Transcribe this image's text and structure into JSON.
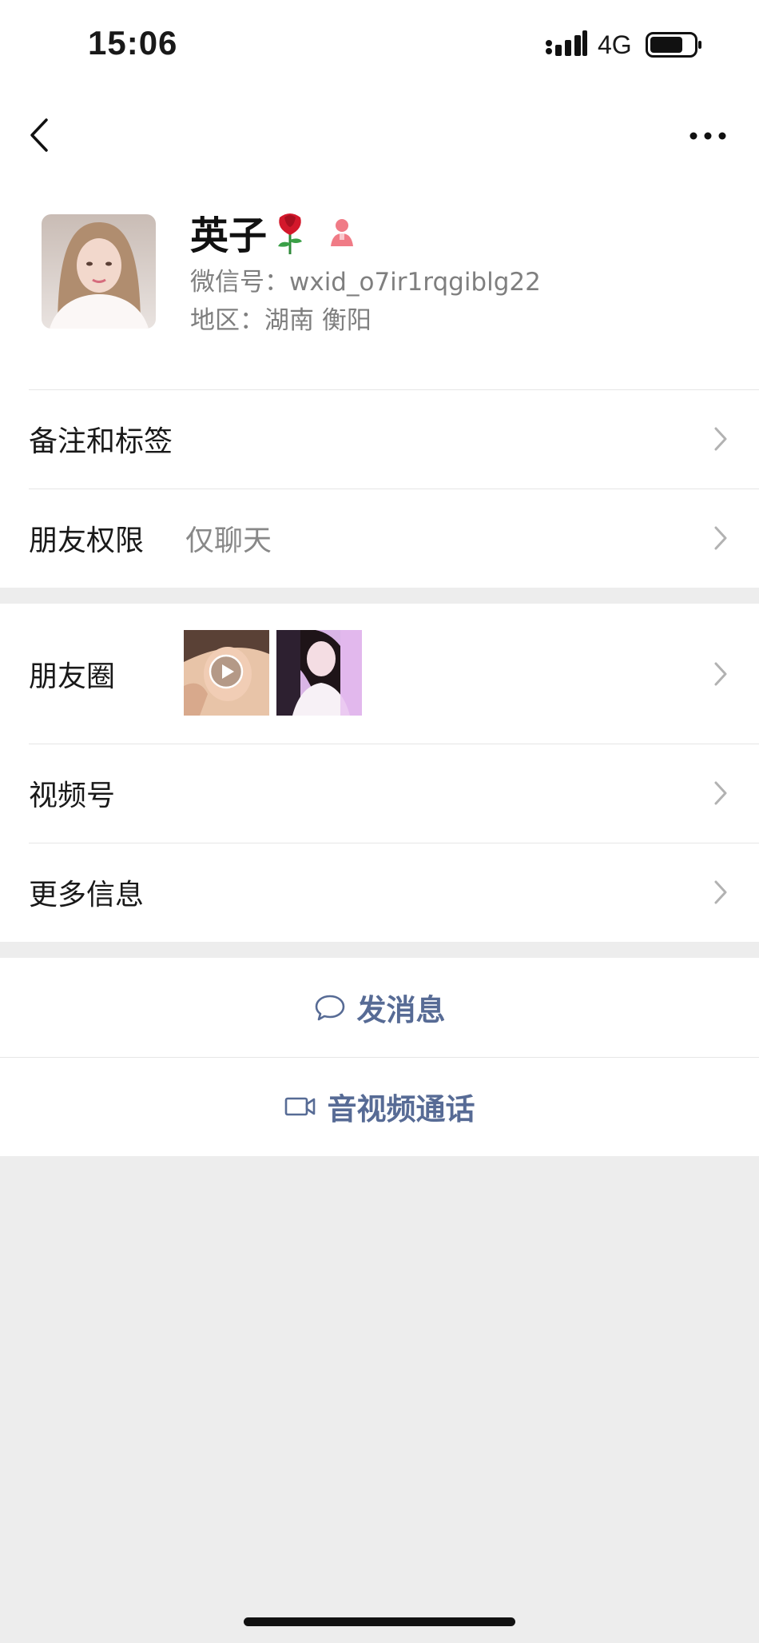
{
  "status_bar": {
    "time": "15:06",
    "network": "4G"
  },
  "nav": {
    "back_icon": "back-chevron-icon",
    "more_icon": "more-dots-icon"
  },
  "profile": {
    "name": "英子",
    "wechat_id": "微信号：wxid_o7ir1rqgiblg22",
    "region": "地区：湖南 衡阳",
    "badge_icons": [
      "rose-icon",
      "female-gender-icon"
    ]
  },
  "rows": {
    "remarks": {
      "label": "备注和标签"
    },
    "permissions": {
      "label": "朋友权限",
      "value": "仅聊天"
    },
    "moments": {
      "label": "朋友圈"
    },
    "channels": {
      "label": "视频号"
    },
    "more_info": {
      "label": "更多信息"
    }
  },
  "actions": {
    "message": {
      "label": "发消息",
      "icon": "chat-bubble-icon"
    },
    "call": {
      "label": "音视频通话",
      "icon": "video-camera-icon"
    }
  },
  "colors": {
    "link_blue": "#576b95",
    "background": "#ededed",
    "secondary_text": "#7f7f7f"
  }
}
